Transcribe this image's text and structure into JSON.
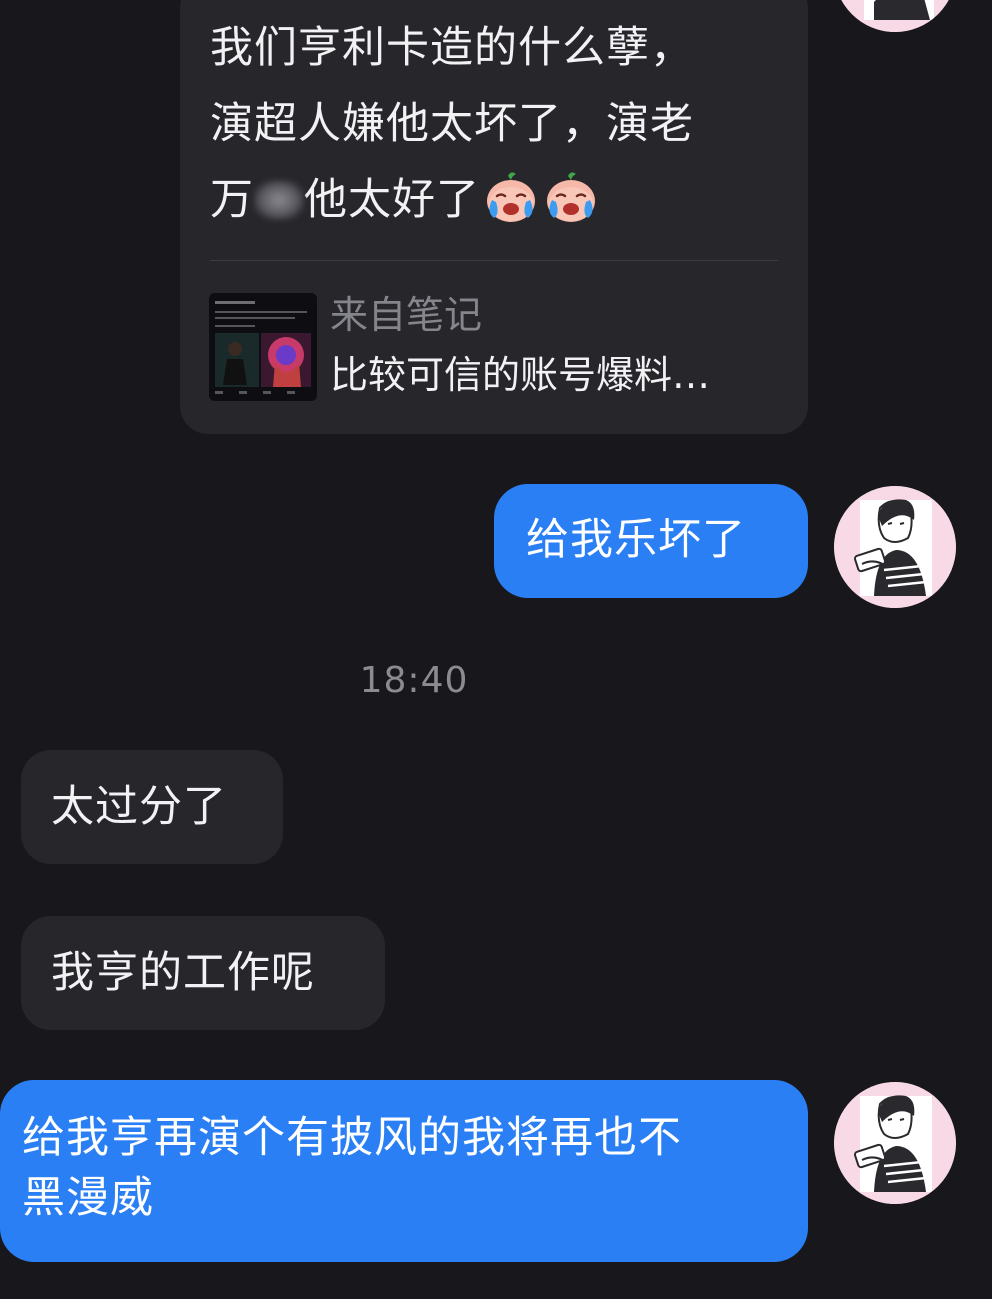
{
  "shared_card": {
    "text_lines": [
      "我们亨利卡造的什么孽，",
      "演超人嫌他太坏了，演老",
      "万",
      "他太好了"
    ],
    "emoji": "loudly-crying-face-icon",
    "source_label": "来自笔记",
    "note_title": "比较可信的账号爆料…"
  },
  "messages": [
    {
      "side": "out",
      "text": "给我乐坏了"
    },
    {
      "side": "time",
      "text": "18:40"
    },
    {
      "side": "in",
      "text": "太过分了"
    },
    {
      "side": "in",
      "text": "我亨的工作呢"
    },
    {
      "side": "out",
      "text_lines": [
        "给我亨再演个有披风的我将再也不",
        "黑漫威"
      ]
    }
  ],
  "colors": {
    "background": "#18181c",
    "outgoing_bubble": "#2a7ff4",
    "incoming_bubble": "#26262b",
    "avatar_bg": "#f8d9e6"
  }
}
